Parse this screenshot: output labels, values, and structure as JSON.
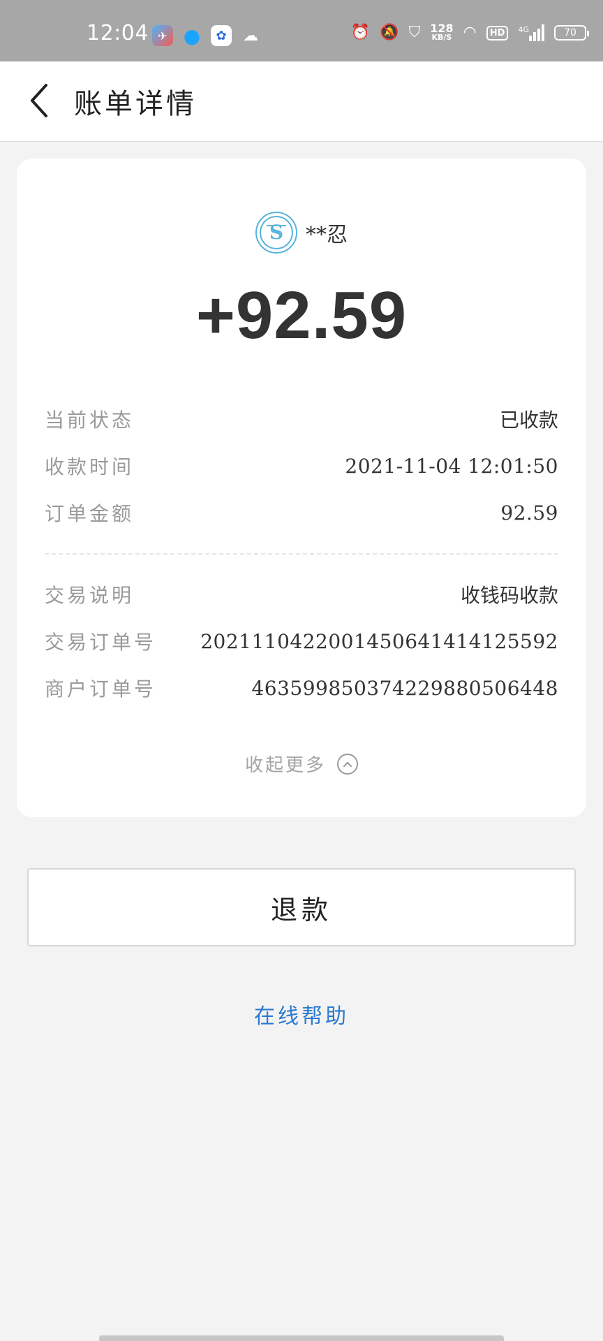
{
  "status_bar": {
    "time": "12:04",
    "speed_value": "128",
    "speed_unit": "KB/S",
    "hd": "HD",
    "network": "4G",
    "battery": "70"
  },
  "header": {
    "title": "账单详情"
  },
  "bill": {
    "merchant_name": "**忍",
    "amount": "+92.59",
    "details": [
      {
        "label": "当前状态",
        "value": "已收款"
      },
      {
        "label": "收款时间",
        "value": "2021-11-04 12:01:50"
      },
      {
        "label": "订单金额",
        "value": "92.59"
      }
    ],
    "more_details": [
      {
        "label": "交易说明",
        "value": "收钱码收款"
      },
      {
        "label": "交易订单号",
        "value": "2021110422001450641414125592"
      },
      {
        "label": "商户订单号",
        "value": "463599850374229880506448"
      }
    ],
    "collapse_label": "收起更多"
  },
  "actions": {
    "refund_label": "退款",
    "help_label": "在线帮助"
  },
  "colors": {
    "status_bar": "#a7a7a7",
    "background": "#f3f3f3",
    "link": "#2b7ad1",
    "avatar_accent": "#5ab4dc"
  }
}
